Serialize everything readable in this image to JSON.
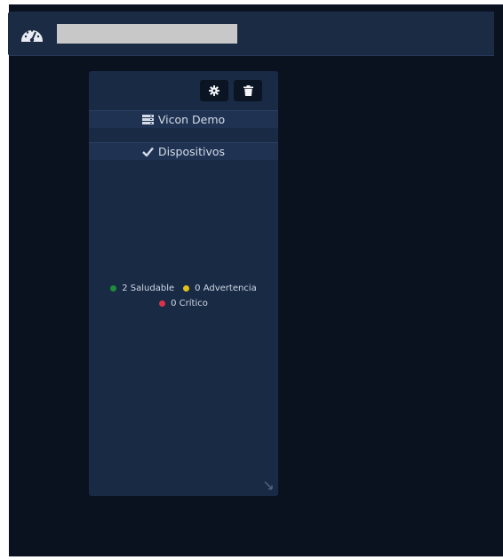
{
  "header": {
    "icon": "dashboard-gauge-icon",
    "title_value": "",
    "title_placeholder": ""
  },
  "widget": {
    "settings_icon": "gear-icon",
    "delete_icon": "trash-icon",
    "server_icon": "server-icon",
    "server_name": "Vicon Demo",
    "devices_icon": "check-icon",
    "devices_label": "Dispositivos",
    "status": {
      "healthy_label": "2 Saludable",
      "warning_label": "0 Advertencia",
      "critical_label": "0 Crítico"
    },
    "resize_icon": "resize-handle-icon"
  },
  "colors": {
    "background": "#0a1220",
    "topbar": "#1b2b44",
    "panel": "#192a45",
    "healthy": "#1e8c3a",
    "warning": "#e0c21b",
    "critical": "#d8334a"
  }
}
